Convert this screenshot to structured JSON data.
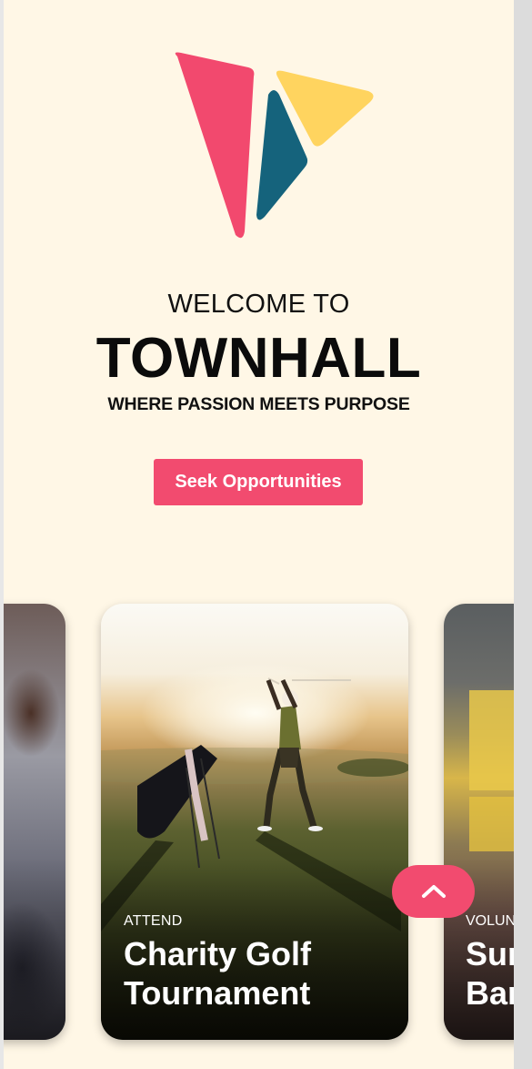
{
  "hero": {
    "welcome": "WELCOME TO",
    "brand": "TOWNHALL",
    "tagline": "WHERE PASSION MEETS PURPOSE",
    "cta_label": "Seek Opportunities"
  },
  "colors": {
    "background": "#fff7e6",
    "accent": "#f24b6f",
    "logo_pink": "#f2496e",
    "logo_teal": "#15637c",
    "logo_yellow": "#ffd45f"
  },
  "cards": [
    {
      "category": "",
      "title": ""
    },
    {
      "category": "ATTEND",
      "title": "Charity Golf Tournament",
      "title_line1": "Charity Golf",
      "title_line2": "Tournament"
    },
    {
      "category": "VOLUNT",
      "title_line1": "Sur",
      "title_line2": "Bar"
    }
  ],
  "scroll_top": {
    "icon": "chevron-up-icon"
  }
}
